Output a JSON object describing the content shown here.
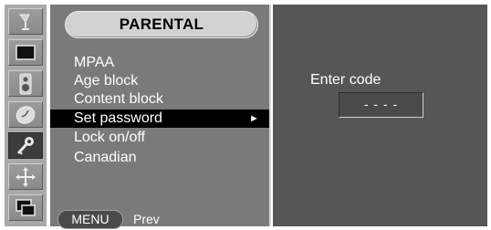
{
  "sidebar": {
    "icons": [
      {
        "name": "antenna-icon"
      },
      {
        "name": "picture-icon"
      },
      {
        "name": "speaker-icon"
      },
      {
        "name": "clock-icon"
      },
      {
        "name": "key-icon",
        "selected": true
      },
      {
        "name": "screen-adjust-icon"
      },
      {
        "name": "pip-icon"
      }
    ]
  },
  "menu": {
    "title": "PARENTAL",
    "items": [
      {
        "label": "MPAA"
      },
      {
        "label": "Age block"
      },
      {
        "label": "Content block"
      },
      {
        "label": "Set password",
        "selected": true,
        "arrow": "►"
      },
      {
        "label": "Lock on/off"
      },
      {
        "label": "Canadian"
      }
    ],
    "footer": {
      "button": "MENU",
      "action": "Prev"
    }
  },
  "password": {
    "label": "Enter code",
    "value": "- - - -"
  },
  "colors": {
    "menu_bg": "#7a7a7a",
    "right_bg": "#565656",
    "selected_row": "#000000"
  }
}
